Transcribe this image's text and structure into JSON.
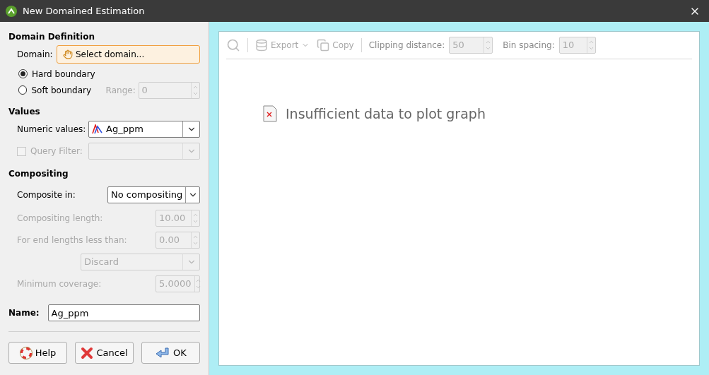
{
  "window": {
    "title": "New Domained Estimation"
  },
  "domain_definition": {
    "heading": "Domain Definition",
    "domain_label": "Domain:",
    "domain_button": "Select domain...",
    "boundaries": [
      {
        "label": "Hard boundary",
        "selected": true
      },
      {
        "label": "Soft boundary",
        "selected": false
      }
    ],
    "range": {
      "label": "Range:",
      "value": "0",
      "disabled": true
    }
  },
  "values": {
    "heading": "Values",
    "numeric": {
      "label": "Numeric values:",
      "value": "Ag_ppm"
    },
    "query_filter": {
      "label": "Query Filter:",
      "checked": false,
      "disabled": true
    }
  },
  "compositing": {
    "heading": "Compositing",
    "composite_in": {
      "label": "Composite in:",
      "value": "No compositing"
    },
    "fields": [
      {
        "kind": "spin",
        "label": "Compositing length:",
        "value": "10.00",
        "disabled": true
      },
      {
        "kind": "spin",
        "label": "For end lengths less than:",
        "value": "0.00",
        "disabled": true
      },
      {
        "kind": "select",
        "value": "Discard",
        "disabled": true
      },
      {
        "kind": "spin",
        "label": "Minimum coverage:",
        "value": "5.0000",
        "disabled": true
      }
    ]
  },
  "name": {
    "label": "Name:",
    "value": "Ag_ppm"
  },
  "buttons": [
    {
      "kind": "help",
      "label": "Help"
    },
    {
      "kind": "cancel",
      "label": "Cancel"
    },
    {
      "kind": "ok",
      "label": "OK"
    }
  ],
  "toolbar": {
    "tools": [
      {
        "kind": "zoom",
        "disabled": true
      },
      {
        "kind": "export",
        "label": "Export",
        "disabled": true
      },
      {
        "kind": "copy",
        "label": "Copy",
        "disabled": true
      }
    ],
    "spins": [
      {
        "label": "Clipping distance:",
        "value": "50"
      },
      {
        "label": "Bin spacing:",
        "value": "10"
      }
    ]
  },
  "message": "Insufficient data to plot graph"
}
